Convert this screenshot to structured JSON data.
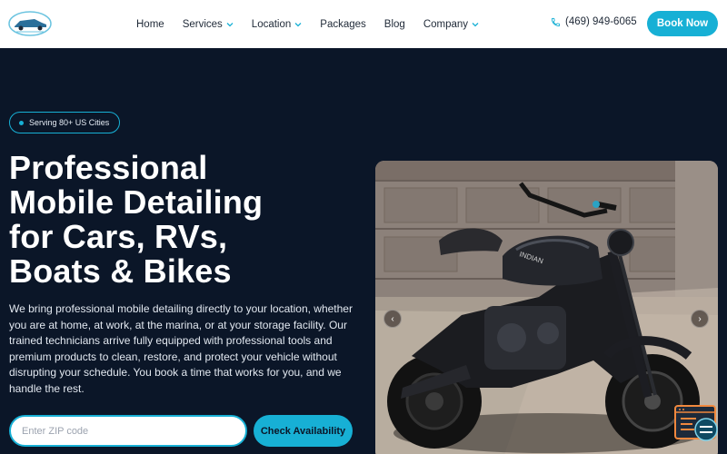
{
  "header": {
    "nav": [
      {
        "label": "Home",
        "has_dropdown": false
      },
      {
        "label": "Services",
        "has_dropdown": true
      },
      {
        "label": "Location",
        "has_dropdown": true
      },
      {
        "label": "Packages",
        "has_dropdown": false
      },
      {
        "label": "Blog",
        "has_dropdown": false
      },
      {
        "label": "Company",
        "has_dropdown": true
      }
    ],
    "phone": "(469) 949-6065",
    "book_label": "Book Now"
  },
  "hero": {
    "badge": "Serving 80+ US Cities",
    "headline_lines": [
      "Professional",
      "Mobile Detailing",
      "for Cars, RVs,",
      "Boats & Bikes"
    ],
    "description": "We bring professional mobile detailing directly to your location, whether you are at home, at work, at the marina, or at your storage facility. Our trained technicians arrive fully equipped with professional tools and premium products to clean, restore, and protect your vehicle without disrupting your schedule. You book a time that works for you, and we handle the rest.",
    "zip_placeholder": "Enter ZIP code",
    "zip_value": "",
    "check_label": "Check Availability"
  },
  "carousel": {
    "prev_glyph": "‹",
    "next_glyph": "›",
    "image_brand_text": "INDIAN"
  },
  "colors": {
    "accent": "#17b0d5",
    "hero_bg": "#0b1628",
    "header_bg": "#ffffff",
    "nav_text": "#1f2937"
  },
  "icons": {
    "logo": "car-logo-icon",
    "phone": "phone-icon",
    "dropdown": "chevron-down-icon",
    "chat": "chat-widget-icon"
  }
}
